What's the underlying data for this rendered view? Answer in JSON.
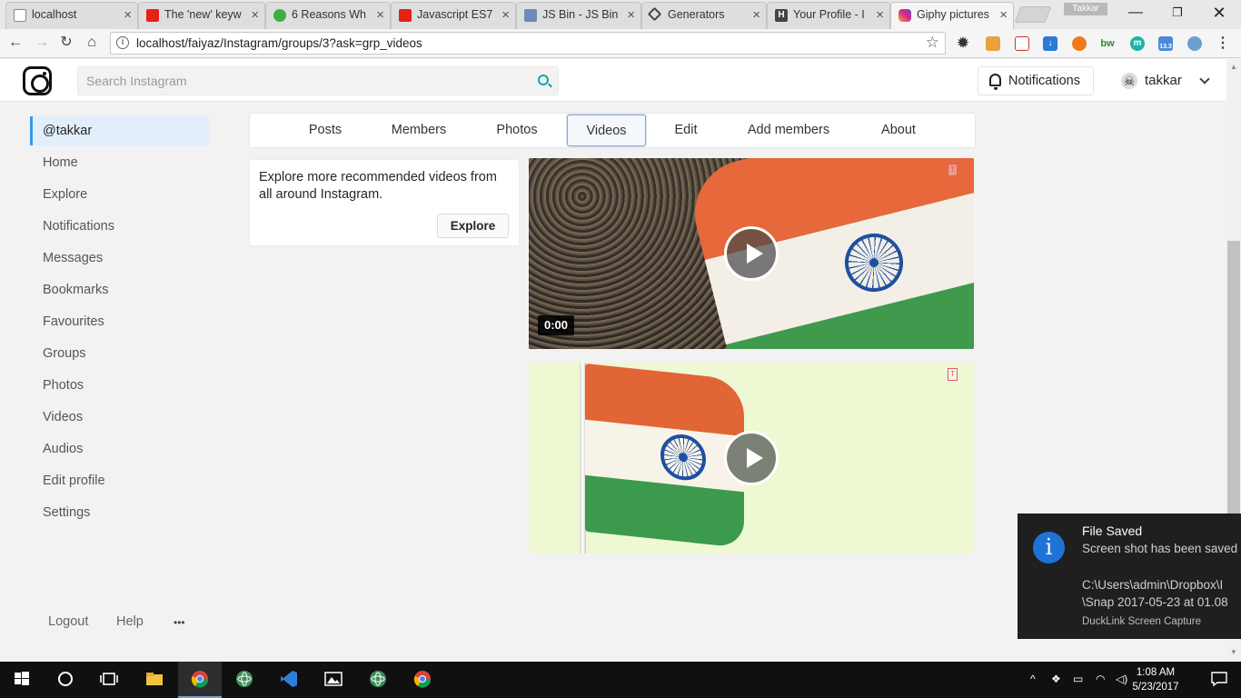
{
  "browser": {
    "tabs": [
      {
        "title": "localhost",
        "icon": "page-icon"
      },
      {
        "title": "The 'new' keyw",
        "icon": "youtube-icon"
      },
      {
        "title": "6 Reasons Wh",
        "icon": "clock-icon"
      },
      {
        "title": "Javascript ES7",
        "icon": "youtube-icon"
      },
      {
        "title": "JS Bin - JS Bin",
        "icon": "jsbin-icon"
      },
      {
        "title": "Generators",
        "icon": "codepen-icon"
      },
      {
        "title": "Your Profile - I",
        "icon": "hashnode-icon"
      },
      {
        "title": "Giphy pictures",
        "icon": "instagram-icon"
      }
    ],
    "profile_name": "Takkar",
    "url": "localhost/faiyaz/Instagram/groups/3?ask=grp_videos",
    "extension_badge": "13.3"
  },
  "header": {
    "search_placeholder": "Search Instagram",
    "notifications_label": "Notifications",
    "username": "takkar"
  },
  "sidebar": {
    "items": [
      {
        "label": "@takkar"
      },
      {
        "label": "Home"
      },
      {
        "label": "Explore"
      },
      {
        "label": "Notifications"
      },
      {
        "label": "Messages"
      },
      {
        "label": "Bookmarks"
      },
      {
        "label": "Favourites"
      },
      {
        "label": "Groups"
      },
      {
        "label": "Photos"
      },
      {
        "label": "Videos"
      },
      {
        "label": "Audios"
      },
      {
        "label": "Edit profile"
      },
      {
        "label": "Settings"
      }
    ],
    "footer": {
      "logout": "Logout",
      "help": "Help",
      "more": "•••"
    }
  },
  "group_tabs": [
    {
      "label": "Posts"
    },
    {
      "label": "Members"
    },
    {
      "label": "Photos"
    },
    {
      "label": "Videos"
    },
    {
      "label": "Edit"
    },
    {
      "label": "Add members"
    },
    {
      "label": "About"
    }
  ],
  "active_tab": "Videos",
  "explore_card": {
    "text": "Explore more recommended videos from all around Instagram.",
    "button": "Explore"
  },
  "videos": [
    {
      "time": "0:00",
      "watermark": "T"
    },
    {
      "time": "",
      "watermark": "T"
    }
  ],
  "toast": {
    "title": "File Saved",
    "message": "Screen shot has been saved",
    "path_line1": "C:\\Users\\admin\\Dropbox\\I",
    "path_line2": "\\Snap 2017-05-23 at 01.08",
    "app": "DuckLink Screen Capture"
  },
  "taskbar": {
    "time": "1:08 AM",
    "date": "5/23/2017"
  },
  "colors": {
    "accent": "#3897f0",
    "search_icon": "#18a2a0",
    "toast_icon": "#1e74d6"
  }
}
